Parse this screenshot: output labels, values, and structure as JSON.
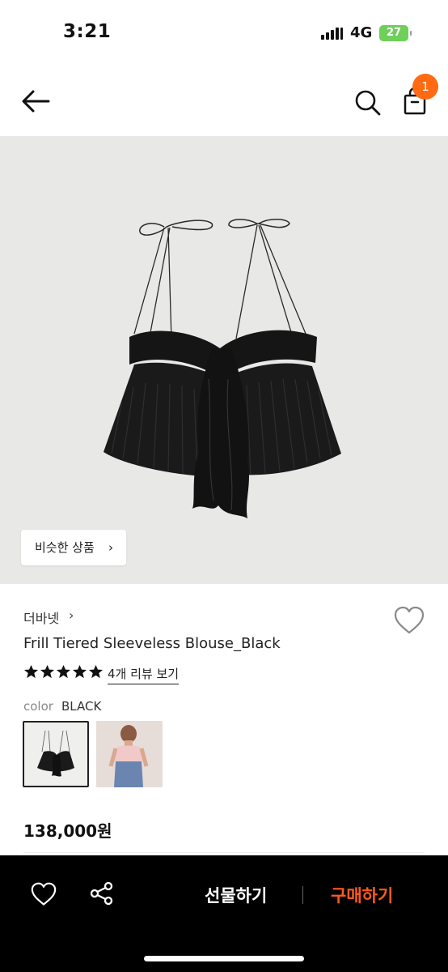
{
  "status_bar": {
    "time": "3:21",
    "network": "4G",
    "battery": "27"
  },
  "header": {
    "cart_count": "1"
  },
  "hero": {
    "similar_label": "비슷한 상품",
    "chevron": "›"
  },
  "product": {
    "brand": "더바넷",
    "brand_chevron": "›",
    "name": "Frill Tiered Sleeveless Blouse_Black",
    "rating_stars": 5,
    "review_link": "4개 리뷰 보기",
    "color_label": "color",
    "color_value": "BLACK",
    "swatches": [
      "black-blouse",
      "pink-blouse-model"
    ],
    "price": "138,000원"
  },
  "bottom_bar": {
    "gift_label": "선물하기",
    "buy_label": "구매하기"
  },
  "colors": {
    "accent": "#ff6a13",
    "buy": "#ff5a1f",
    "bar": "#000000",
    "hero_bg": "#e8e8e6"
  },
  "icons": [
    "back-arrow-icon",
    "search-icon",
    "shopping-bag-icon",
    "heart-icon",
    "share-icon",
    "star-icon"
  ]
}
